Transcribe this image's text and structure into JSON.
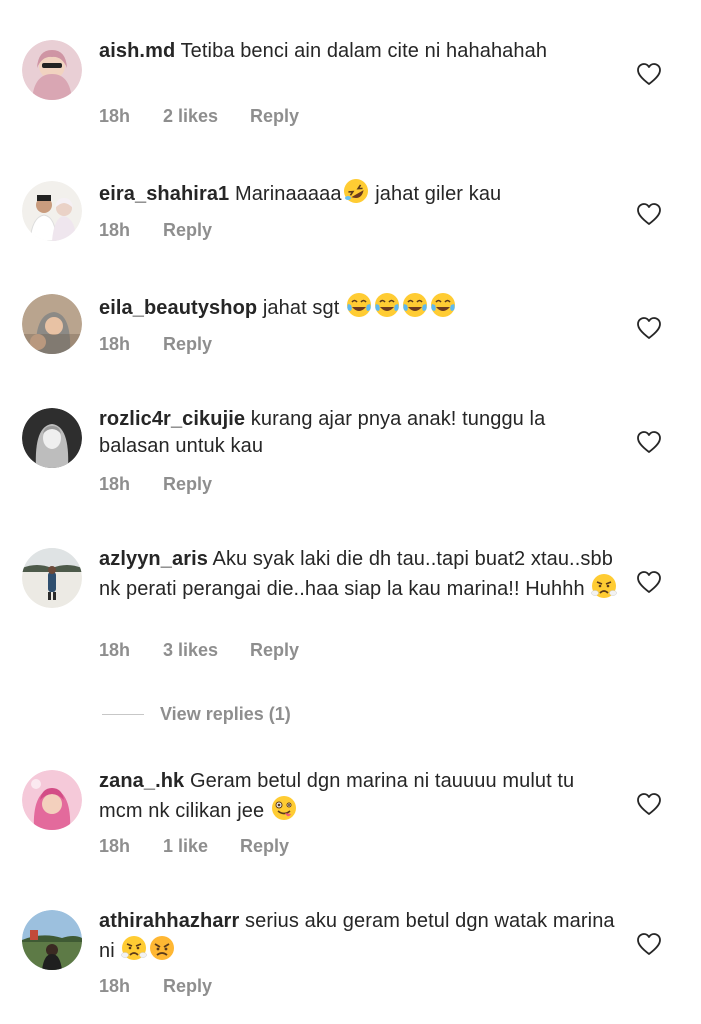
{
  "comments": [
    {
      "username": "aish.md",
      "text": "Tetiba benci ain dalam cite ni hahahahah",
      "time": "18h",
      "likes": "2 likes",
      "reply": "Reply",
      "avatar_color": "#d9a6b3"
    },
    {
      "username": "eira_shahira1",
      "text": "Marinaaaaa",
      "text_after": "jahat giler kau",
      "time": "18h",
      "likes": "",
      "reply": "Reply",
      "avatar_color": "#e8e6e1"
    },
    {
      "username": "eila_beautyshop",
      "text": "jahat sgt",
      "time": "18h",
      "likes": "",
      "reply": "Reply",
      "avatar_color": "#c9a98e"
    },
    {
      "username": "rozlic4r_cikujie",
      "text": "kurang ajar pnya anak! tunggu la balasan untuk kau",
      "time": "18h",
      "likes": "",
      "reply": "Reply",
      "avatar_color": "#3a3a3a"
    },
    {
      "username": "azlyyn_aris",
      "text": "Aku syak laki die dh tau..tapi buat2 xtau..sbb nk perati perangai die..haa siap la kau marina!! Huhhh",
      "time": "18h",
      "likes": "3 likes",
      "reply": "Reply",
      "avatar_color": "#dcd8cf"
    },
    {
      "username": "zana_.hk",
      "text": "Geram betul dgn marina ni tauuuu mulut tu mcm nk cilikan jee",
      "time": "18h",
      "likes": "1 like",
      "reply": "Reply",
      "avatar_color": "#e38fb0"
    },
    {
      "username": "athirahhazharr",
      "text": "serius aku geram betul dgn watak marina ni",
      "time": "18h",
      "likes": "",
      "reply": "Reply",
      "avatar_color": "#6f8fa6"
    }
  ],
  "view_replies": "View replies (1)",
  "colors": {
    "text": "#262626",
    "muted": "#8e8e8e",
    "line": "#c7c7c7"
  },
  "icons": {
    "heart": "heart-outline-icon",
    "emoji_rofl": "rofl-emoji-icon",
    "emoji_joy": "tears-of-joy-emoji-icon",
    "emoji_triumph": "face-with-steam-emoji-icon",
    "emoji_crazy": "zany-face-emoji-icon",
    "emoji_angry": "angry-face-emoji-icon"
  }
}
